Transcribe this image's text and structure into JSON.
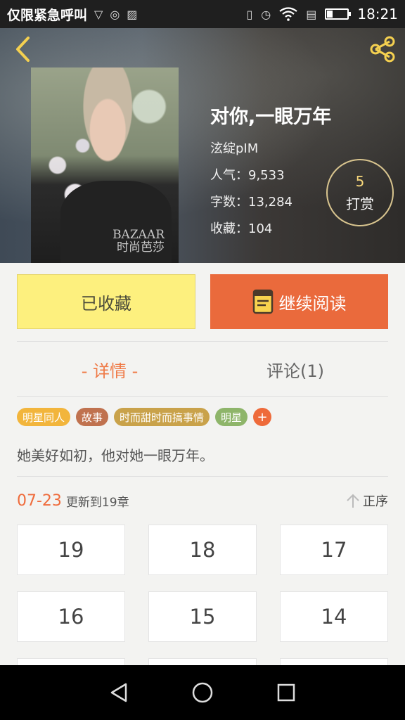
{
  "status_bar": {
    "carrier": "仅限紧急呼叫",
    "time": "18:21"
  },
  "book": {
    "title": "对你,一眼万年",
    "author": "泫绽pIM",
    "popularity_label": "人气：",
    "popularity_value": "9,533",
    "words_label": "字数：",
    "words_value": "13,284",
    "favorites_label": "收藏：",
    "favorites_value": "104",
    "cover_text_line1": "BAZAAR",
    "cover_text_line2": "时尚芭莎"
  },
  "reward": {
    "count": "5",
    "label": "打赏"
  },
  "actions": {
    "collected_label": "已收藏",
    "continue_label": "继续阅读"
  },
  "tabs": [
    {
      "label": "- 详情 -",
      "active": true
    },
    {
      "label": "评论(1)",
      "active": false
    }
  ],
  "tags": [
    {
      "label": "明星同人",
      "color": "#f2b53c"
    },
    {
      "label": "故事",
      "color": "#c0724f"
    },
    {
      "label": "时而甜时而搞事情",
      "color": "#c9a24a"
    },
    {
      "label": "明星",
      "color": "#8eb56a"
    }
  ],
  "tag_add": "+",
  "summary": "她美好如初，他对她一眼万年。",
  "update": {
    "date": "07-23",
    "text": "更新到19章",
    "sort_label": "正序"
  },
  "chapters": [
    "19",
    "18",
    "17",
    "16",
    "15",
    "14",
    "",
    "",
    ""
  ],
  "colors": {
    "accent": "#ea6a3c",
    "collect_bg": "#fdf07e"
  }
}
